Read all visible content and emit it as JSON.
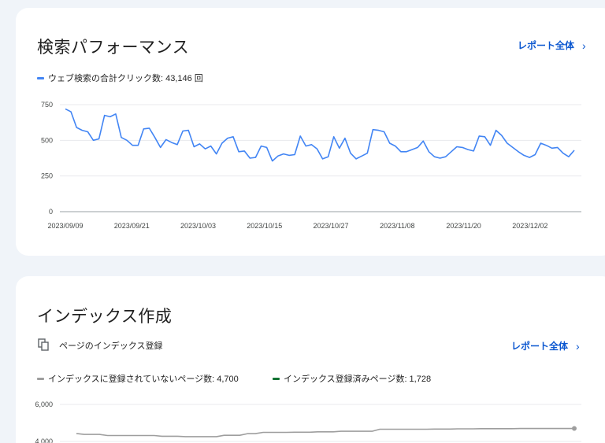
{
  "performance": {
    "title": "検索パフォーマンス",
    "report_link": "レポート全体",
    "legend": "ウェブ検索の合計クリック数: 43,146 回",
    "accent": "#4285f4",
    "chart_data": {
      "type": "line",
      "title": "",
      "ylim": [
        0,
        750
      ],
      "yticks": [
        "750",
        "500",
        "250",
        "0"
      ],
      "xticks": [
        "2023/09/09",
        "2023/09/21",
        "2023/10/03",
        "2023/10/15",
        "2023/10/27",
        "2023/11/08",
        "2023/11/20",
        "2023/12/02"
      ],
      "x_start": "2023/09/09",
      "x_end": "2023/12/10",
      "series": [
        {
          "name": "ウェブ検索の合計クリック数",
          "color": "#4285f4",
          "values": [
            720,
            700,
            590,
            570,
            560,
            500,
            510,
            675,
            665,
            685,
            520,
            500,
            465,
            465,
            580,
            585,
            520,
            450,
            505,
            485,
            470,
            565,
            570,
            455,
            475,
            440,
            460,
            405,
            480,
            515,
            525,
            420,
            425,
            375,
            380,
            460,
            450,
            355,
            390,
            405,
            395,
            400,
            530,
            460,
            470,
            440,
            370,
            385,
            525,
            445,
            515,
            410,
            370,
            390,
            410,
            575,
            570,
            560,
            480,
            460,
            420,
            420,
            435,
            450,
            495,
            420,
            385,
            375,
            385,
            420,
            455,
            450,
            435,
            425,
            530,
            525,
            465,
            570,
            535,
            480,
            450,
            420,
            395,
            380,
            400,
            480,
            465,
            445,
            450,
            410,
            385,
            430
          ]
        }
      ]
    }
  },
  "indexing": {
    "title": "インデックス作成",
    "subtitle": "ページのインデックス登録",
    "report_link": "レポート全体",
    "legend": [
      {
        "label": "インデックスに登録されていないページ数: 4,700",
        "color": "#9e9e9e"
      },
      {
        "label": "インデックス登録済みページ数: 1,728",
        "color": "#137333"
      }
    ],
    "chart_data": {
      "type": "line",
      "title": "",
      "ylim": [
        0,
        6000
      ],
      "yticks": [
        "6,000",
        "4,000"
      ],
      "series": [
        {
          "name": "インデックスに登録されていないページ数",
          "color": "#9e9e9e",
          "values": [
            4430,
            4380,
            4380,
            4380,
            4320,
            4320,
            4320,
            4320,
            4320,
            4320,
            4320,
            4280,
            4280,
            4280,
            4260,
            4260,
            4260,
            4260,
            4260,
            4330,
            4330,
            4330,
            4420,
            4420,
            4490,
            4490,
            4490,
            4490,
            4500,
            4500,
            4500,
            4520,
            4520,
            4520,
            4550,
            4550,
            4550,
            4550,
            4550,
            4660,
            4660,
            4660,
            4660,
            4660,
            4660,
            4660,
            4670,
            4670,
            4670,
            4680,
            4680,
            4680,
            4690,
            4690,
            4690,
            4690,
            4690,
            4700,
            4700,
            4700,
            4700,
            4700,
            4700,
            4700,
            4700
          ]
        }
      ]
    }
  }
}
